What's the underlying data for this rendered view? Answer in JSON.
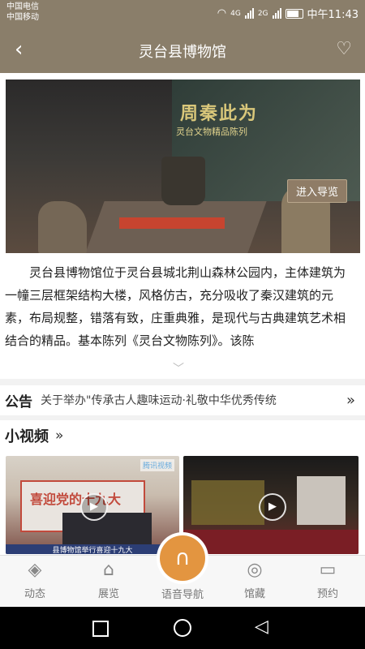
{
  "status": {
    "carrier1": "中国电信",
    "carrier2": "中国移动",
    "time": "中午11:43",
    "network1": "4G",
    "network2": "2G"
  },
  "header": {
    "back_icon": "chevron-left-icon",
    "title": "灵台县博物馆",
    "favorite_icon": "heart-icon"
  },
  "hero": {
    "exhibit_title": "周秦此为",
    "exhibit_subtitle": "灵台文物精品陈列",
    "guide_button": "进入导览"
  },
  "intro": {
    "text": "灵台县博物馆位于灵台县城北荆山森林公园内，主体建筑为一幢三层框架结构大楼，风格仿古，充分吸收了秦汉建筑的元素，布局规整，错落有致，庄重典雅，是现代与古典建筑艺术相结合的精品。基本陈列《灵台文物陈列》。该陈"
  },
  "notice": {
    "label": "公告",
    "text": "关于举办\"传承古人趣味运动·礼敬中华优秀传统",
    "more_icon": "double-chevron-right-icon"
  },
  "videos": {
    "title": "小视频",
    "more_icon": "double-chevron-right-icon",
    "items": [
      {
        "banner": "喜迎党的十九大",
        "tag": "腾讯视频",
        "caption": "县博物馆举行喜迎十九大"
      },
      {
        "tag": ""
      }
    ]
  },
  "tabbar": {
    "items": [
      {
        "label": "动态",
        "icon": "layers-icon"
      },
      {
        "label": "展览",
        "icon": "museum-icon"
      },
      {
        "label": "语音导航",
        "icon": "headphones-icon"
      },
      {
        "label": "馆藏",
        "icon": "pin-icon"
      },
      {
        "label": "预约",
        "icon": "monitor-icon"
      }
    ]
  },
  "colors": {
    "header_bg": "#8a7e6a",
    "accent": "#e39540"
  }
}
